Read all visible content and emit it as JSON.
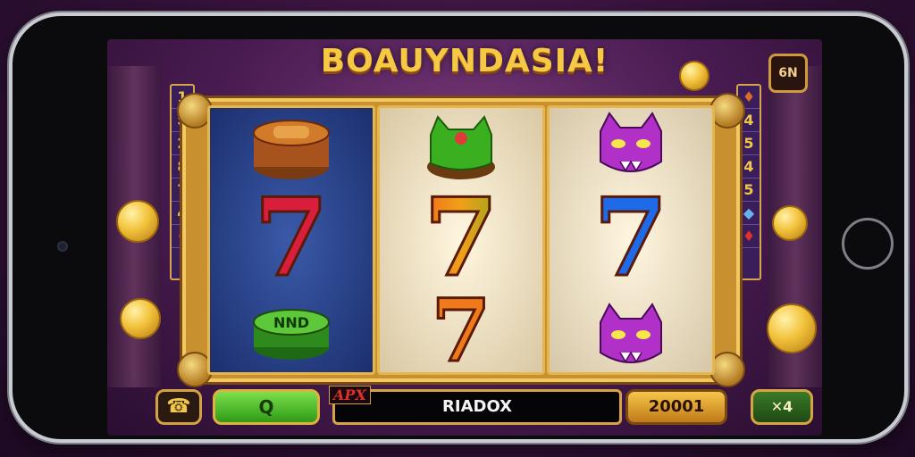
{
  "game": {
    "title": "BOAUYNDASIA!",
    "top_button": "6N"
  },
  "reels": [
    {
      "top": "barrel-chip-icon",
      "middle": "7",
      "bottom": "green-chip-icon"
    },
    {
      "top": "green-cat-icon",
      "middle": "7",
      "bottom": "7"
    },
    {
      "top": "purple-cat-icon",
      "middle": "7",
      "bottom": "purple-cat-icon"
    }
  ],
  "paylines_left": [
    "1",
    "S",
    "2",
    "8",
    "7",
    "4",
    "♦"
  ],
  "paylines_right": [
    "♦",
    "4",
    "5",
    "4",
    "5",
    "◆",
    "♦"
  ],
  "colors": {
    "seven_red": "#d81e3a",
    "seven_rainbow_start": "#f03a1e",
    "seven_green": "#3ab020",
    "seven_blue": "#1e6ae8",
    "seven_orange": "#f07a1a",
    "gold": "#f2c84a"
  },
  "controls": {
    "phone_icon": "☎",
    "green_button": "Q",
    "apx_label": "APX",
    "display_text": "RIADOX",
    "bet_value": "20001",
    "auto_label": "✕4"
  }
}
